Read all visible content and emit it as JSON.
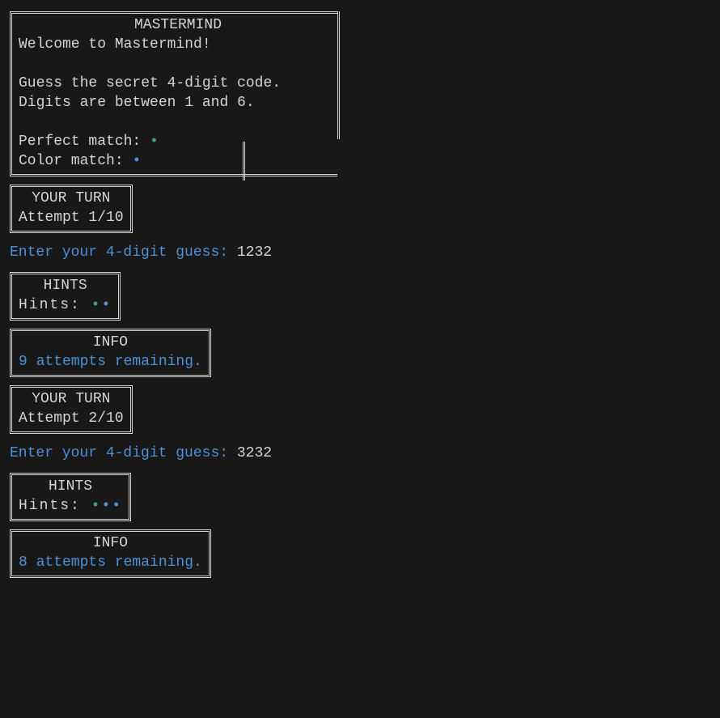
{
  "colors": {
    "bg": "#181818",
    "fg": "#d4d4d4",
    "blue": "#4e8fd6",
    "green": "#3fa66f"
  },
  "intro": {
    "title": "MASTERMIND",
    "welcome": "Welcome to Mastermind!",
    "line1": "Guess the secret 4-digit code.",
    "line2": "Digits are between 1 and 6.",
    "perfect_label": "Perfect match: ",
    "perfect_symbol": "•",
    "color_label": "Color match: ",
    "color_symbol": "•"
  },
  "turns": [
    {
      "turn_title": "YOUR TURN",
      "attempt_label": "Attempt 1/10",
      "prompt": "Enter your 4-digit guess: ",
      "guess": "1232",
      "hints_title": "HINTS",
      "hints_label": "Hints: ",
      "hints_perfect": "•",
      "hints_color": "•",
      "info_title": "INFO",
      "info_text": "9 attempts remaining."
    },
    {
      "turn_title": "YOUR TURN",
      "attempt_label": "Attempt 2/10",
      "prompt": "Enter your 4-digit guess: ",
      "guess": "3232",
      "hints_title": "HINTS",
      "hints_label": "Hints: ",
      "hints_perfect": "•",
      "hints_color": "••",
      "info_title": "INFO",
      "info_text": "8 attempts remaining."
    }
  ]
}
